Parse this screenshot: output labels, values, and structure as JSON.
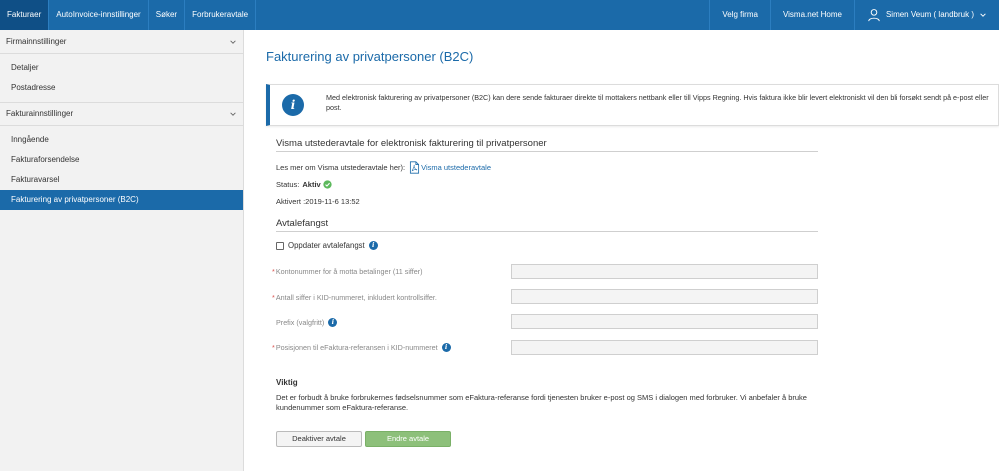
{
  "topbar": {
    "tabs": [
      {
        "label": "Fakturaer",
        "active": true
      },
      {
        "label": "AutoInvoice-innstillinger",
        "active": false
      },
      {
        "label": "Søker",
        "active": false
      },
      {
        "label": "Forbrukeravtale",
        "active": false
      }
    ],
    "choose_company": "Velg firma",
    "home": "Visma.net Home",
    "user": "Simen Veum ( landbruk )"
  },
  "sidebar": {
    "sections": [
      {
        "title": "Firmainnstillinger",
        "items": [
          "Detaljer",
          "Postadresse"
        ]
      },
      {
        "title": "Fakturainnstillinger",
        "items": [
          "Inngående",
          "Fakturaforsendelse",
          "Fakturavarsel",
          "Fakturering av privatpersoner (B2C)"
        ]
      }
    ],
    "active_item": "Fakturering av privatpersoner (B2C)"
  },
  "main": {
    "title": "Fakturering av privatpersoner (B2C)",
    "info_text": "Med elektronisk fakturering av privatpersoner (B2C) kan dere sende fakturaer direkte til mottakers nettbank eller till Vipps Regning. Hvis faktura ikke blir levert elektroniskt vil den bli forsøkt sendt på e-post eller post.",
    "agreement": {
      "heading": "Visma utstederavtale for elektronisk fakturering til privatpersoner",
      "read_more": "Les mer om Visma utstederavtale her):",
      "link": "Visma utstederavtale",
      "status_label": "Status:",
      "status_value": "Aktiv",
      "activated": "Aktivert :2019-11-6 13:52"
    },
    "capture": {
      "heading": "Avtalefangst",
      "checkbox_label": "Oppdater avtalefangst",
      "fields": [
        {
          "label": "Kontonummer for å motta betalinger (11 siffer)",
          "required": true,
          "info": false,
          "value": ""
        },
        {
          "label": "Antall siffer i KID-nummeret, inkludert kontrollsiffer.",
          "required": true,
          "info": false,
          "value": ""
        },
        {
          "label": "Prefix (valgfritt)",
          "required": false,
          "info": true,
          "value": ""
        },
        {
          "label": "Posisjonen til eFaktura-referansen i KID-nummeret",
          "required": true,
          "info": true,
          "value": ""
        }
      ],
      "required_mark": "*"
    },
    "important": {
      "title": "Viktig",
      "text": "Det er forbudt å bruke forbrukernes fødselsnummer som eFaktura-referanse fordi tjenesten bruker e-post og SMS i dialogen med forbruker. Vi anbefaler å bruke kundenummer som eFaktura-referanse."
    },
    "buttons": {
      "deactivate": "Deaktiver avtale",
      "change": "Endre avtale"
    }
  },
  "colors": {
    "brand_blue": "#1b6aa9",
    "success_green": "#5cb85c",
    "button_green": "#8dc07a"
  }
}
